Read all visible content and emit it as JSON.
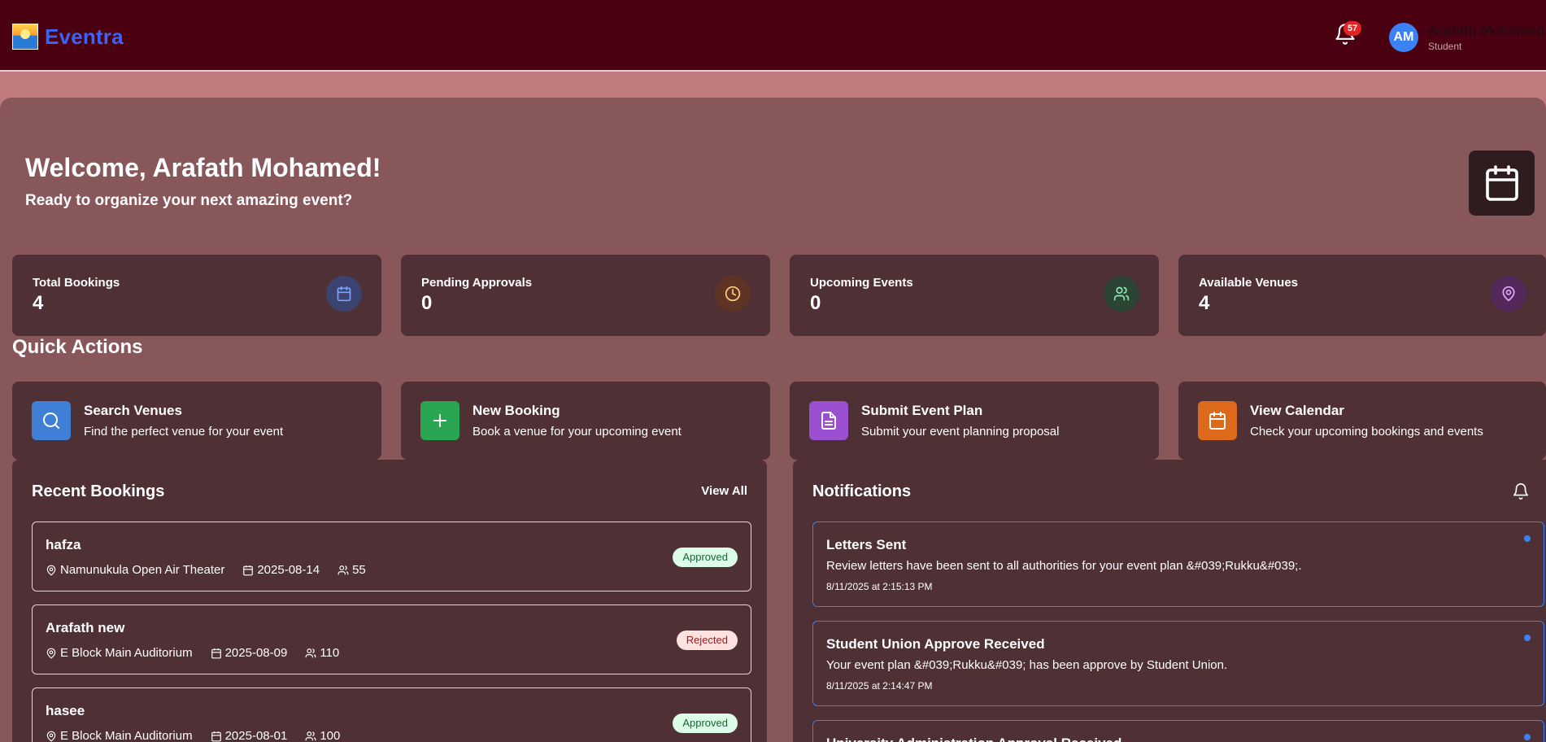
{
  "header": {
    "brand": "Eventra",
    "notification_count": "57",
    "user_initials": "AM",
    "user_name": "Arafath Mohamed",
    "user_role": "Student"
  },
  "welcome": {
    "title": "Welcome, Arafath Mohamed!",
    "subtitle": "Ready to organize your next amazing event?"
  },
  "stats": [
    {
      "label": "Total Bookings",
      "value": "4",
      "icon": "calendar-icon",
      "color": "#3b4470"
    },
    {
      "label": "Pending Approvals",
      "value": "0",
      "icon": "clock-icon",
      "color": "#5f3424"
    },
    {
      "label": "Upcoming Events",
      "value": "0",
      "icon": "users-icon",
      "color": "#2c4434"
    },
    {
      "label": "Available Venues",
      "value": "4",
      "icon": "map-pin-icon",
      "color": "#55285b"
    }
  ],
  "quick_actions": {
    "title": "Quick Actions",
    "items": [
      {
        "title": "Search Venues",
        "desc": "Find the perfect venue for your event",
        "icon": "search-icon",
        "color": "#3f7fd8"
      },
      {
        "title": "New Booking",
        "desc": "Book a venue for your upcoming event",
        "icon": "plus-icon",
        "color": "#2aa653"
      },
      {
        "title": "Submit Event Plan",
        "desc": "Submit your event planning proposal",
        "icon": "document-icon",
        "color": "#9b4fd1"
      },
      {
        "title": "View Calendar",
        "desc": "Check your upcoming bookings and events",
        "icon": "calendar-icon",
        "color": "#dd6a1a"
      }
    ]
  },
  "recent_bookings": {
    "title": "Recent Bookings",
    "view_all": "View All",
    "items": [
      {
        "name": "hafza",
        "venue": "Namunukula Open Air Theater",
        "date": "2025-08-14",
        "attendees": "55",
        "status": "Approved"
      },
      {
        "name": "Arafath new",
        "venue": "E Block Main Auditorium",
        "date": "2025-08-09",
        "attendees": "110",
        "status": "Rejected"
      },
      {
        "name": "hasee",
        "venue": "E Block Main Auditorium",
        "date": "2025-08-01",
        "attendees": "100",
        "status": "Approved"
      }
    ]
  },
  "notifications": {
    "title": "Notifications",
    "items": [
      {
        "title": "Letters Sent",
        "message": "Review letters have been sent to all authorities for your event plan &#039;Rukku&#039;.",
        "time": "8/11/2025 at 2:15:13 PM"
      },
      {
        "title": "Student Union Approve Received",
        "message": "Your event plan &#039;Rukku&#039; has been approve by Student Union.",
        "time": "8/11/2025 at 2:14:47 PM"
      },
      {
        "title": "University Administration Approval Received",
        "message": "",
        "time": ""
      }
    ]
  }
}
